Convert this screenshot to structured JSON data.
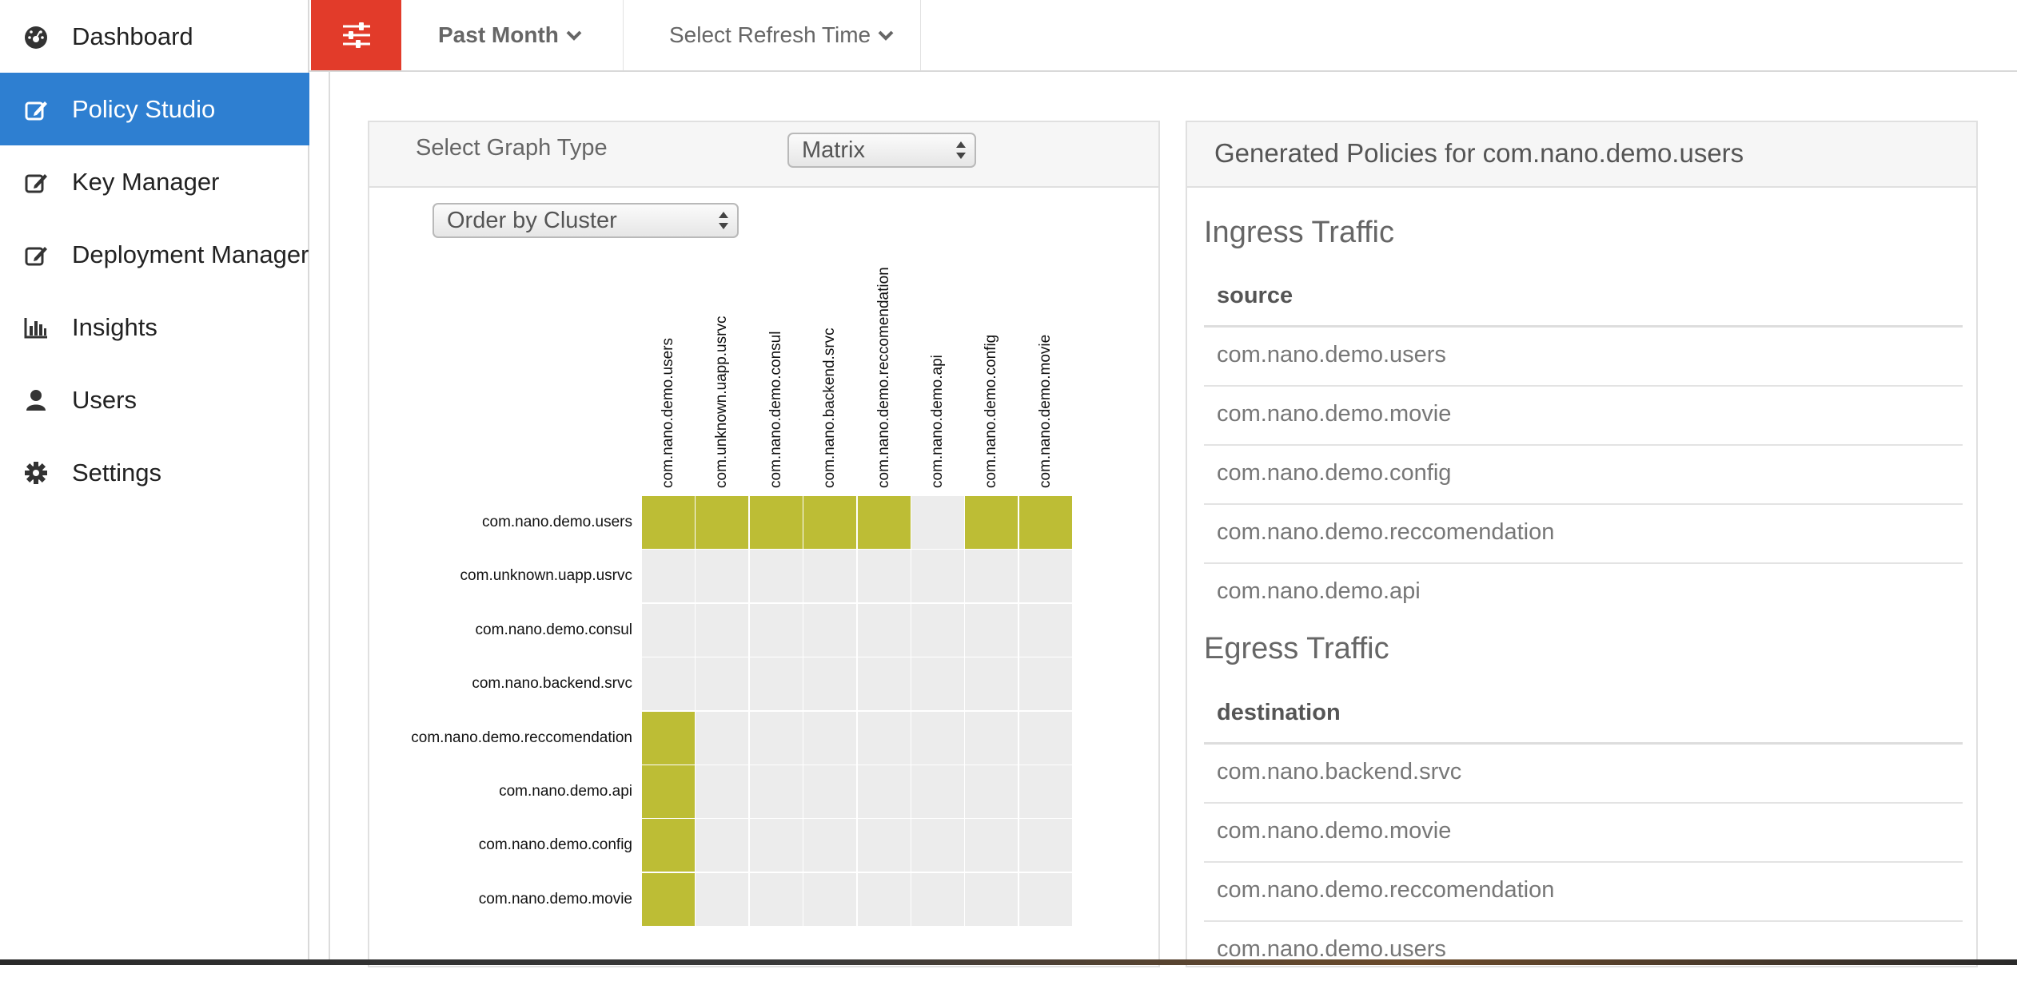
{
  "sidebar": {
    "items": [
      {
        "label": "Dashboard",
        "icon": "dashboard-icon",
        "active": false
      },
      {
        "label": "Policy Studio",
        "icon": "edit-icon",
        "active": true
      },
      {
        "label": "Key Manager",
        "icon": "edit-icon",
        "active": false
      },
      {
        "label": "Deployment Manager",
        "icon": "edit-icon",
        "active": false
      },
      {
        "label": "Insights",
        "icon": "bar-chart-icon",
        "active": false
      },
      {
        "label": "Users",
        "icon": "user-icon",
        "active": false
      },
      {
        "label": "Settings",
        "icon": "gear-icon",
        "active": false
      }
    ]
  },
  "topbar": {
    "filter_icon": "sliders-icon",
    "time_range": "Past Month",
    "refresh": "Select Refresh Time"
  },
  "graph": {
    "type_label": "Select Graph Type",
    "type_value": "Matrix",
    "order_value": "Order by Cluster",
    "columns": [
      "com.nano.demo.users",
      "com.unknown.uapp.usrvc",
      "com.nano.demo.consul",
      "com.nano.backend.srvc",
      "com.nano.demo.reccomendation",
      "com.nano.demo.api",
      "com.nano.demo.config",
      "com.nano.demo.movie"
    ],
    "rows": [
      "com.nano.demo.users",
      "com.unknown.uapp.usrvc",
      "com.nano.demo.consul",
      "com.nano.backend.srvc",
      "com.nano.demo.reccomendation",
      "com.nano.demo.api",
      "com.nano.demo.config",
      "com.nano.demo.movie"
    ],
    "matrix": [
      [
        1,
        1,
        1,
        1,
        1,
        0,
        1,
        1
      ],
      [
        0,
        0,
        0,
        0,
        0,
        0,
        0,
        0
      ],
      [
        0,
        0,
        0,
        0,
        0,
        0,
        0,
        0
      ],
      [
        0,
        0,
        0,
        0,
        0,
        0,
        0,
        0
      ],
      [
        1,
        0,
        0,
        0,
        0,
        0,
        0,
        0
      ],
      [
        1,
        0,
        0,
        0,
        0,
        0,
        0,
        0
      ],
      [
        1,
        0,
        0,
        0,
        0,
        0,
        0,
        0
      ],
      [
        1,
        0,
        0,
        0,
        0,
        0,
        0,
        0
      ]
    ],
    "colors": {
      "active": "#bdbd35",
      "empty": "#ececec",
      "blank": "#ffffff"
    }
  },
  "policies": {
    "title": "Generated Policies for com.nano.demo.users",
    "ingress_title": "Ingress Traffic",
    "ingress_header": "source",
    "ingress": [
      "com.nano.demo.users",
      "com.nano.demo.movie",
      "com.nano.demo.config",
      "com.nano.demo.reccomendation",
      "com.nano.demo.api"
    ],
    "egress_title": "Egress Traffic",
    "egress_header": "destination",
    "egress": [
      "com.nano.backend.srvc",
      "com.nano.demo.movie",
      "com.nano.demo.reccomendation",
      "com.nano.demo.users"
    ]
  }
}
